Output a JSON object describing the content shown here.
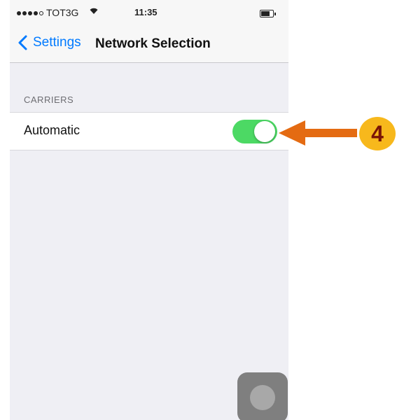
{
  "status_bar": {
    "carrier": "TOT3G",
    "wifi_icon": "wifi-icon",
    "time": "11:35",
    "signal_strength": 4,
    "signal_max": 5
  },
  "nav": {
    "back_label": "Settings",
    "title": "Network Selection"
  },
  "section": {
    "header": "CARRIERS"
  },
  "rows": [
    {
      "label": "Automatic",
      "toggle_on": true
    }
  ],
  "annotation": {
    "step_number": "4",
    "arrow_color": "#e46b12",
    "badge_color": "#f7b81c",
    "number_color": "#7a1406"
  },
  "colors": {
    "accent": "#007aff",
    "toggle_on": "#4cd964",
    "background": "#efeff4"
  }
}
